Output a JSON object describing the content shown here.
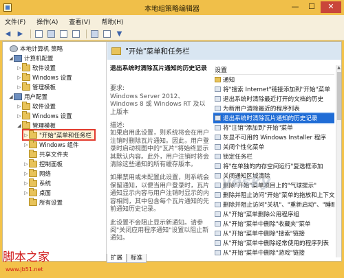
{
  "window": {
    "title": "本地组策略编辑器",
    "controls": {
      "minimize": "—",
      "maximize": "☐",
      "close": "✕"
    }
  },
  "menu": [
    "文件(F)",
    "操作(A)",
    "查看(V)",
    "帮助(H)"
  ],
  "tree": {
    "items": [
      {
        "label": "本地计算机 策略",
        "level": 0,
        "icon": "computer-policy-icon",
        "expander": ""
      },
      {
        "label": "计算机配置",
        "level": 1,
        "icon": "computer-icon",
        "expander": "◢"
      },
      {
        "label": "软件设置",
        "level": 2,
        "icon": "folder-icon",
        "expander": "▷"
      },
      {
        "label": "Windows 设置",
        "level": 2,
        "icon": "folder-icon",
        "expander": "▷"
      },
      {
        "label": "管理模板",
        "level": 2,
        "icon": "folder-icon",
        "expander": "▷"
      },
      {
        "label": "用户配置",
        "level": 1,
        "icon": "user-icon",
        "expander": "◢"
      },
      {
        "label": "软件设置",
        "level": 2,
        "icon": "folder-icon",
        "expander": "▷"
      },
      {
        "label": "Windows 设置",
        "level": 2,
        "icon": "folder-icon",
        "expander": "▷"
      },
      {
        "label": "管理模板",
        "level": 2,
        "icon": "folder-icon",
        "expander": "◢"
      },
      {
        "label": "\"开始\"菜单和任务栏",
        "level": 3,
        "icon": "folder-icon",
        "expander": "▷",
        "selected": true
      },
      {
        "label": "Windows 组件",
        "level": 3,
        "icon": "folder-icon",
        "expander": "▷"
      },
      {
        "label": "共享文件夹",
        "level": 3,
        "icon": "folder-icon",
        "expander": ""
      },
      {
        "label": "控制面板",
        "level": 3,
        "icon": "folder-icon",
        "expander": "▷"
      },
      {
        "label": "网络",
        "level": 3,
        "icon": "folder-icon",
        "expander": "▷"
      },
      {
        "label": "系统",
        "level": 3,
        "icon": "folder-icon",
        "expander": "▷"
      },
      {
        "label": "桌面",
        "level": 3,
        "icon": "folder-icon",
        "expander": "▷"
      },
      {
        "label": "所有设置",
        "level": 3,
        "icon": "folder-icon",
        "expander": ""
      }
    ]
  },
  "right": {
    "banner_title": "\"开始\"菜单和任务栏",
    "description": {
      "heading": "退出系统时清除瓦片通知的历史记录",
      "requires_label": "要求:",
      "requires": "Windows Server 2012、Windows 8 或 Windows RT 及以上版本",
      "description_label": "描述:",
      "para1": "如果启用此设置，则系统将会在用户注销时删除瓦片通知。因此，用户登录时启动视图中的\"瓦片\"将始终显示其默认内容。此外，用户注销时将会清除这些通知的所有缓存版本。",
      "para2": "如果禁用或未配置此设置，则系统会保留通知，以便当用户登录时，瓦片通知显示内容与用户注销时显示的内容相同，其中包含每个瓦片通知的先前通知历史记录。",
      "para3": "此设置不会阻止显示新通知。请参阅\"关闭应用程序通知\"设置以阻止新通知。"
    },
    "list_header": "设置",
    "rows": [
      {
        "label": "通知",
        "type": "folder"
      },
      {
        "label": "将\"搜索 Internet\"链接添加到\"开始\"菜单",
        "type": "setting"
      },
      {
        "label": "退出系统时清除最近打开的文档的历史",
        "type": "setting"
      },
      {
        "label": "为新用户清除最近的程序列表",
        "type": "setting"
      },
      {
        "label": "退出系统时清除瓦片通知的历史记录",
        "type": "setting",
        "selected": true
      },
      {
        "label": "将\"注销\"添加到\"开始\"菜单",
        "type": "setting"
      },
      {
        "label": "灰显不可用的 Windows Installer 程序",
        "type": "setting"
      },
      {
        "label": "关闭个性化菜单",
        "type": "setting"
      },
      {
        "label": "锁定任务栏",
        "type": "setting"
      },
      {
        "label": "将\"在单独的内存空间运行\"复选框添加",
        "type": "setting"
      },
      {
        "label": "关闭通知区域清除",
        "type": "setting"
      },
      {
        "label": "删除\"开始\"菜单项目上的\"气球提示\"",
        "type": "setting"
      },
      {
        "label": "删除并阻止访问\"开始\"菜单的拖放和上下文菜单",
        "type": "setting"
      },
      {
        "label": "删除并阻止访问\"关机\"、\"重新启动\"、\"睡眠\"",
        "type": "setting"
      },
      {
        "label": "从\"开始\"菜单删除公用程序组",
        "type": "setting"
      },
      {
        "label": "从\"开始\"菜单中删除\"收藏夹\"菜单",
        "type": "setting"
      },
      {
        "label": "从\"开始\"菜单中删除\"搜索\"链接",
        "type": "setting"
      },
      {
        "label": "从\"开始\"菜单中删除经常使用的程序列表",
        "type": "setting"
      },
      {
        "label": "从\"开始\"菜单中删除\"游戏\"链接",
        "type": "setting"
      }
    ]
  },
  "tabs": [
    "扩展",
    "标准"
  ],
  "watermark": {
    "site_name": "脚本之家",
    "url": "www.jb51.net"
  }
}
